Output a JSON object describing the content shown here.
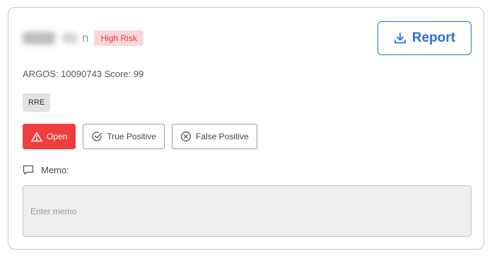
{
  "header": {
    "name_visible_fragment": "n",
    "risk_badge": "High Risk"
  },
  "report_button": {
    "label": "Report",
    "icon": "download-icon"
  },
  "meta": {
    "line": "ARGOS: 10090743 Score: 99"
  },
  "tag": {
    "label": "RRE"
  },
  "actions": {
    "open_label": "Open",
    "true_positive_label": "True Positive",
    "false_positive_label": "False Positive"
  },
  "memo": {
    "label": "Memo:",
    "placeholder": "Enter memo",
    "value": ""
  },
  "colors": {
    "accent": "#2b6fd6",
    "danger": "#f03d3d",
    "badge_bg": "#fbd7da",
    "badge_text": "#d93a3a"
  }
}
